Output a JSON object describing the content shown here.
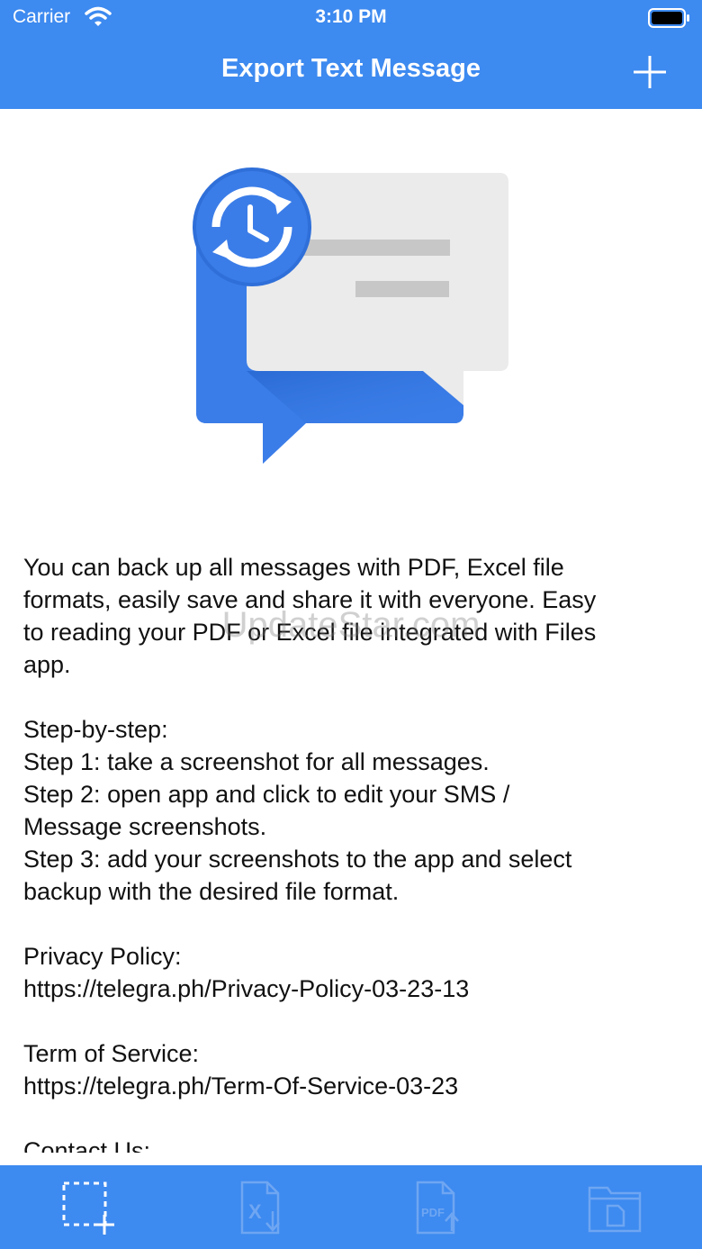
{
  "status_bar": {
    "carrier": "Carrier",
    "time": "3:10 PM"
  },
  "nav": {
    "title": "Export Text Message",
    "add_icon": "plus-icon"
  },
  "content": {
    "intro": [
      "You can back up all messages with PDF, Excel file",
      "formats, easily save and share it with everyone. Easy",
      "to reading your PDF or Excel file integrated with Files",
      "app."
    ],
    "steps_heading": "Step-by-step:",
    "steps": [
      "Step 1: take a screenshot for all messages.",
      "Step 2: open app and click to edit your SMS /",
      "Message screenshots.",
      "Step 3: add your screenshots to the app and select",
      "backup with the desired file format."
    ],
    "privacy_label": "Privacy Policy:",
    "privacy_url": "https://telegra.ph/Privacy-Policy-03-23-13",
    "terms_label": "Term of Service:",
    "terms_url": "https://telegra.ph/Term-Of-Service-03-23",
    "contact_label": "Contact Us:"
  },
  "watermark": "UpdateStar.com",
  "tabs": [
    {
      "icon": "screenshot-select-icon",
      "active": true
    },
    {
      "icon": "excel-export-icon",
      "active": false
    },
    {
      "icon": "pdf-export-icon",
      "active": false
    },
    {
      "icon": "files-folder-icon",
      "active": false
    }
  ],
  "colors": {
    "brand_blue": "#3d8af0",
    "icon_blue": "#3b7de8",
    "bubble_gray": "#ebebeb"
  }
}
